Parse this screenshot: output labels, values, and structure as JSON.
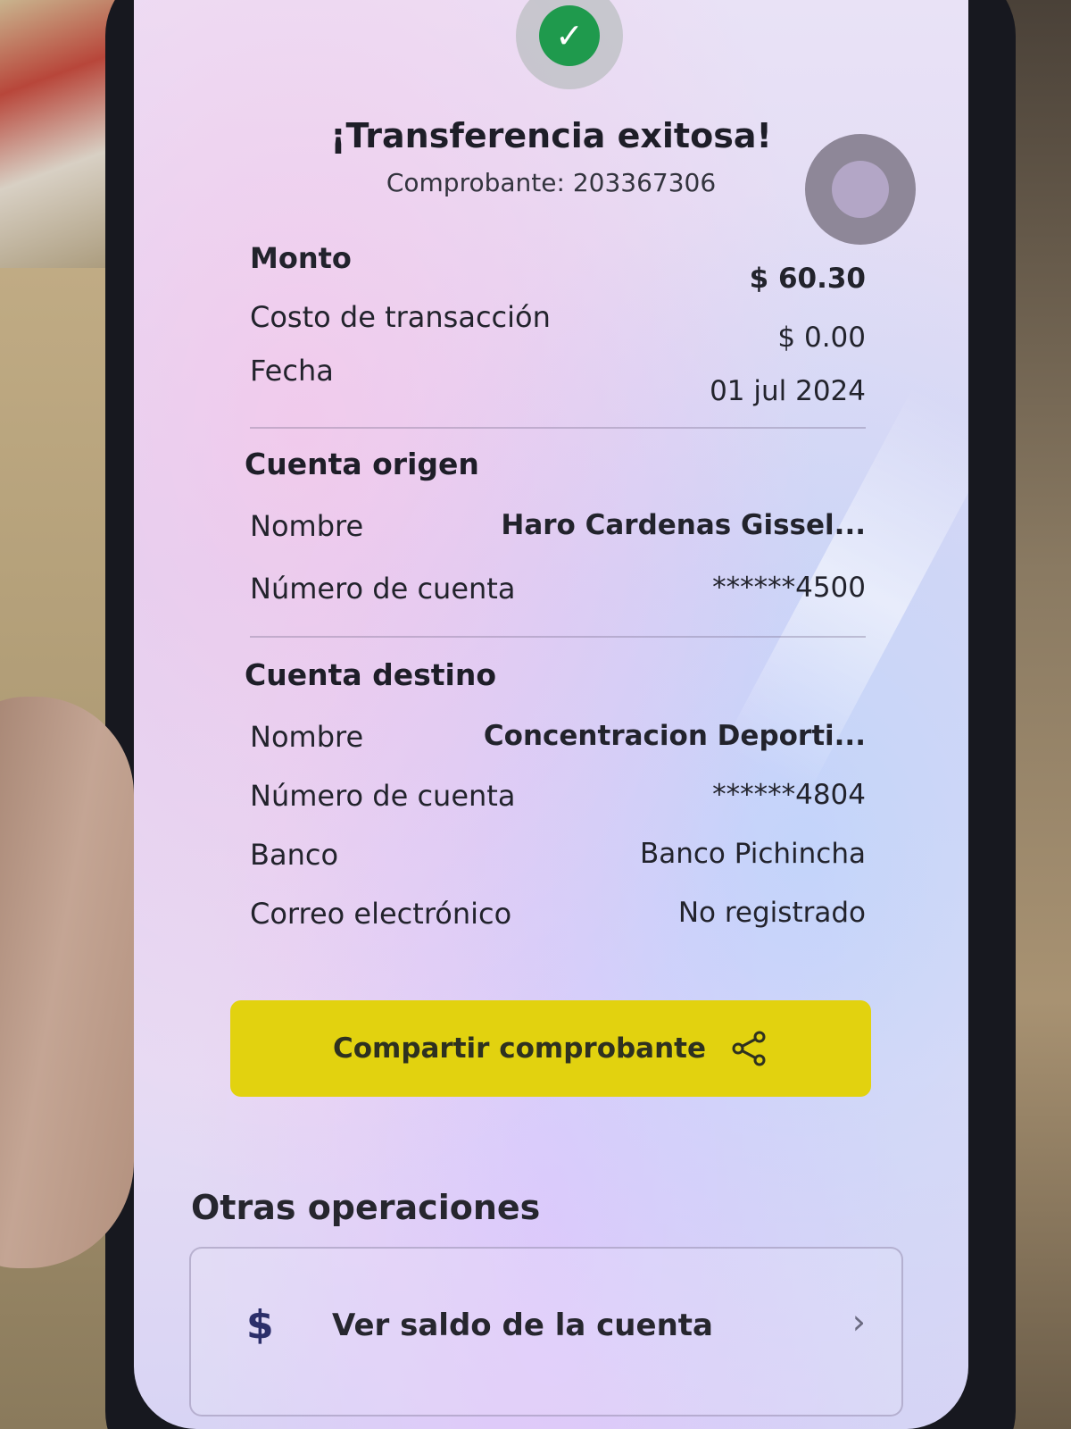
{
  "header": {
    "title": "¡Transferencia exitosa!",
    "receipt": "Comprobante: 203367306"
  },
  "summary": {
    "amount_label": "Monto",
    "amount_value": "$ 60.30",
    "cost_label": "Costo de transacción",
    "cost_value": "$ 0.00",
    "date_label": "Fecha",
    "date_value": "01 jul 2024"
  },
  "origin": {
    "title": "Cuenta origen",
    "name_label": "Nombre",
    "name_value": "Haro  Cardenas Gissel...",
    "account_label": "Número de cuenta",
    "account_value": "******4500"
  },
  "destination": {
    "title": "Cuenta destino",
    "name_label": "Nombre",
    "name_value": "Concentracion Deporti...",
    "account_label": "Número de cuenta",
    "account_value": "******4804",
    "bank_label": "Banco",
    "bank_value": "Banco Pichincha",
    "email_label": "Correo electrónico",
    "email_value": "No registrado"
  },
  "actions": {
    "share_label": "Compartir comprobante"
  },
  "other_operations": {
    "title": "Otras operaciones",
    "items": [
      {
        "icon": "$",
        "label": "Ver saldo de la cuenta",
        "chevron": "›"
      }
    ]
  },
  "colors": {
    "success": "#1f9a4d",
    "share_button": "#e2d20f",
    "dollar_icon": "#2c2f6a"
  }
}
